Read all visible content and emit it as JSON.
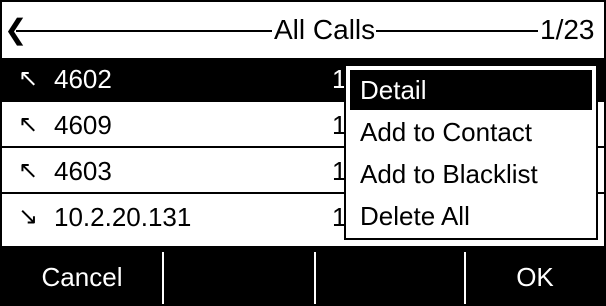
{
  "title_bar": {
    "back_icon": "chevron-left-icon",
    "back_glyph": "❮",
    "title": "All Calls",
    "page_counter": "1/23"
  },
  "calls": [
    {
      "direction": "incoming",
      "icon_glyph": "↖",
      "number": "4602",
      "trail": "1"
    },
    {
      "direction": "incoming",
      "icon_glyph": "↖",
      "number": "4609",
      "trail": "1"
    },
    {
      "direction": "incoming",
      "icon_glyph": "↖",
      "number": "4603",
      "trail": "1"
    },
    {
      "direction": "outgoing",
      "icon_glyph": "↘",
      "number": "10.2.20.131",
      "trail": "1"
    }
  ],
  "popup_menu": {
    "items": [
      "Detail",
      "Add to Contact",
      "Add to Blacklist",
      "Delete All"
    ],
    "selected_index": 0
  },
  "softkeys": {
    "left": "Cancel",
    "mid1": "",
    "mid2": "",
    "right": "OK"
  },
  "colors": {
    "background": "#ffffff",
    "foreground": "#000000",
    "highlight_bg": "#000000",
    "highlight_fg": "#ffffff"
  }
}
